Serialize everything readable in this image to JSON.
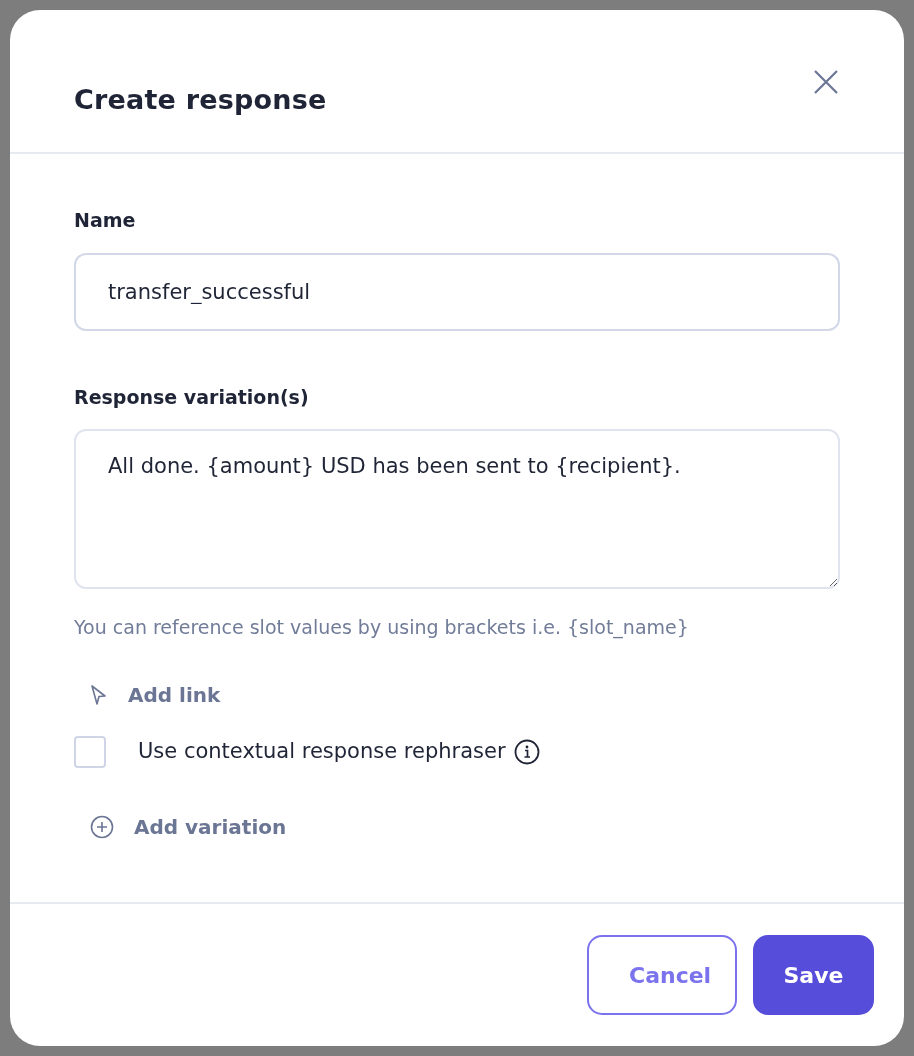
{
  "dialog": {
    "title": "Create response"
  },
  "name_field": {
    "label": "Name",
    "value": "transfer_successful"
  },
  "variation_field": {
    "label": "Response variation(s)",
    "value": "All done. {amount} USD has been sent to {recipient}.",
    "hint": "You can reference slot values by using brackets i.e. {slot_name}"
  },
  "add_link": {
    "label": "Add link"
  },
  "rephraser": {
    "label": "Use contextual response rephraser",
    "checked": false
  },
  "add_variation": {
    "label": "Add variation"
  },
  "buttons": [
    {
      "label": "Cancel",
      "kind": "secondary"
    },
    {
      "label": "Save",
      "kind": "primary"
    }
  ]
}
